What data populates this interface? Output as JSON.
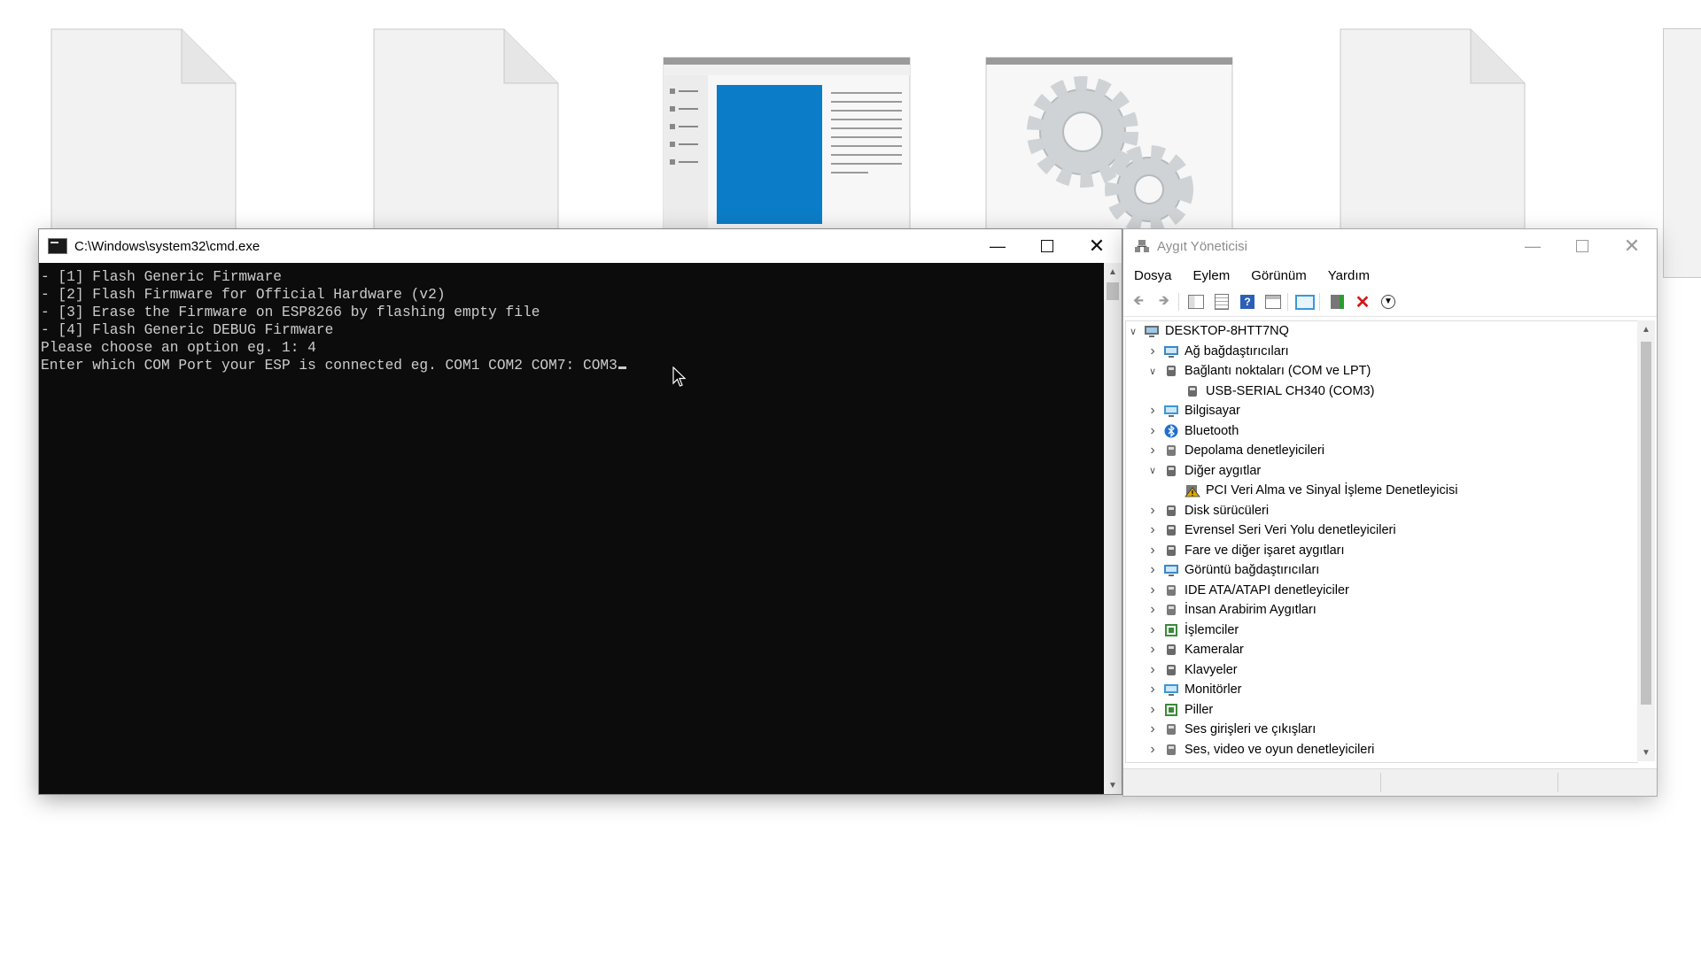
{
  "desktop": {
    "icons": [
      {
        "name": "document-icon"
      },
      {
        "name": "document-icon"
      },
      {
        "name": "window-list-icon"
      },
      {
        "name": "settings-gears-icon"
      },
      {
        "name": "document-icon"
      }
    ]
  },
  "cmd": {
    "title": "C:\\Windows\\system32\\cmd.exe",
    "lines": [
      "- [1] Flash Generic Firmware",
      "- [2] Flash Firmware for Official Hardware (v2)",
      "- [3] Erase the Firmware on ESP8266 by flashing empty file",
      "- [4] Flash Generic DEBUG Firmware",
      "Please choose an option eg. 1: 4",
      "Enter which COM Port your ESP is connected eg. COM1 COM2 COM7: COM3"
    ]
  },
  "devmgr": {
    "title": "Aygıt Yöneticisi",
    "menu": [
      "Dosya",
      "Eylem",
      "Görünüm",
      "Yardım"
    ],
    "root": "DESKTOP-8HTT7NQ",
    "tree": [
      {
        "label": "Ağ bağdaştırıcıları",
        "level": 1,
        "state": "collapsed",
        "icon": "network-adapter-icon",
        "color": "#3b87c8"
      },
      {
        "label": "Bağlantı noktaları (COM ve LPT)",
        "level": 1,
        "state": "expanded",
        "icon": "port-icon",
        "color": "#6a6a6a"
      },
      {
        "label": "USB-SERIAL CH340 (COM3)",
        "level": 2,
        "state": "leaf",
        "icon": "port-icon",
        "color": "#6a6a6a"
      },
      {
        "label": "Bilgisayar",
        "level": 1,
        "state": "collapsed",
        "icon": "computer-icon",
        "color": "#3b98d6"
      },
      {
        "label": "Bluetooth",
        "level": 1,
        "state": "collapsed",
        "icon": "bluetooth-icon",
        "color": "#1f6fd1"
      },
      {
        "label": "Depolama denetleyicileri",
        "level": 1,
        "state": "collapsed",
        "icon": "storage-controller-icon",
        "color": "#7a7a7a"
      },
      {
        "label": "Diğer aygıtlar",
        "level": 1,
        "state": "expanded",
        "icon": "unknown-device-icon",
        "color": "#6a6a6a"
      },
      {
        "label": "PCI Veri Alma ve Sinyal İşleme Denetleyicisi",
        "level": 2,
        "state": "leaf",
        "icon": "warning-device-icon",
        "color": "#e0a800"
      },
      {
        "label": "Disk sürücüleri",
        "level": 1,
        "state": "collapsed",
        "icon": "disk-drive-icon",
        "color": "#6a6a6a"
      },
      {
        "label": "Evrensel Seri Veri Yolu denetleyicileri",
        "level": 1,
        "state": "collapsed",
        "icon": "usb-icon",
        "color": "#6a6a6a"
      },
      {
        "label": "Fare ve diğer işaret aygıtları",
        "level": 1,
        "state": "collapsed",
        "icon": "mouse-icon",
        "color": "#6a6a6a"
      },
      {
        "label": "Görüntü bağdaştırıcıları",
        "level": 1,
        "state": "collapsed",
        "icon": "display-adapter-icon",
        "color": "#3b87c8"
      },
      {
        "label": "IDE ATA/ATAPI denetleyiciler",
        "level": 1,
        "state": "collapsed",
        "icon": "ide-controller-icon",
        "color": "#7a7a7a"
      },
      {
        "label": "İnsan Arabirim Aygıtları",
        "level": 1,
        "state": "collapsed",
        "icon": "hid-icon",
        "color": "#7a7a7a"
      },
      {
        "label": "İşlemciler",
        "level": 1,
        "state": "collapsed",
        "icon": "processor-icon",
        "color": "#3a8a3a"
      },
      {
        "label": "Kameralar",
        "level": 1,
        "state": "collapsed",
        "icon": "camera-icon",
        "color": "#6a6a6a"
      },
      {
        "label": "Klavyeler",
        "level": 1,
        "state": "collapsed",
        "icon": "keyboard-icon",
        "color": "#6a6a6a"
      },
      {
        "label": "Monitörler",
        "level": 1,
        "state": "collapsed",
        "icon": "monitor-icon",
        "color": "#3b98d6"
      },
      {
        "label": "Piller",
        "level": 1,
        "state": "collapsed",
        "icon": "battery-icon",
        "color": "#3a8a3a"
      },
      {
        "label": "Ses girişleri ve çıkışları",
        "level": 1,
        "state": "collapsed",
        "icon": "speaker-icon",
        "color": "#7a7a7a"
      },
      {
        "label": "Ses, video ve oyun denetleyicileri",
        "level": 1,
        "state": "collapsed",
        "icon": "sound-controller-icon",
        "color": "#7a7a7a"
      }
    ]
  }
}
